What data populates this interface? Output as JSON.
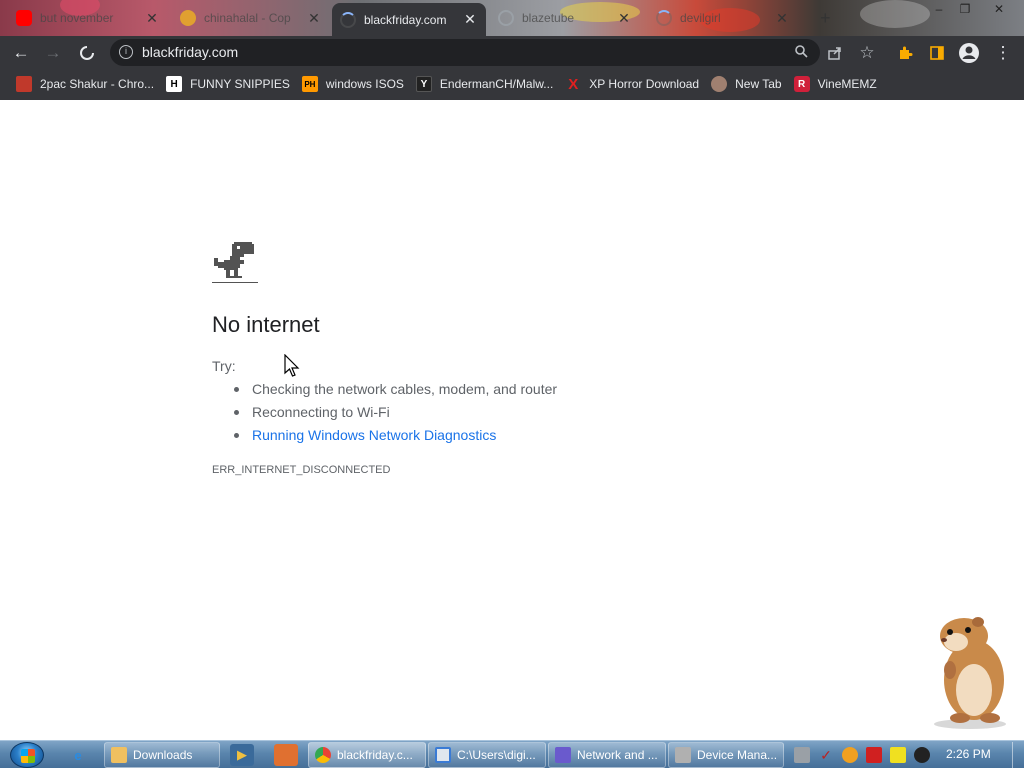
{
  "window": {
    "tabs": [
      {
        "title": "but november",
        "favicon": "youtube-icon",
        "color": "#ff0000"
      },
      {
        "title": "chinahalal - Cop",
        "favicon": "site-favicon-icon",
        "color": "#e0a030"
      },
      {
        "title": "blackfriday.com",
        "favicon": "loading-spinner-icon",
        "active": true
      },
      {
        "title": "blazetube",
        "favicon": "globe-icon",
        "color": "#9aa0a6"
      },
      {
        "title": "devilgirl",
        "favicon": "loading-spinner-icon"
      }
    ],
    "new_tab": "+",
    "controls": {
      "minimize": "–",
      "restore": "❐",
      "close": "✕"
    }
  },
  "toolbar": {
    "back": "←",
    "forward": "→",
    "reload": "✕",
    "url": "blackfriday.com",
    "info": "i",
    "icons": [
      "search-icon",
      "share-icon",
      "bookmark-star-icon",
      "extensions-icon",
      "side-panel-icon",
      "profile-icon",
      "menu-icon"
    ]
  },
  "bookmarks": [
    {
      "label": "2pac Shakur - Chro...",
      "icon": "image-icon",
      "text": "",
      "color": "#c0392b"
    },
    {
      "label": "FUNNY SNIPPIES",
      "icon": "h-letter-icon",
      "text": "H",
      "color": "#ffffff"
    },
    {
      "label": "windows ISOS",
      "icon": "ph-icon",
      "text": "PH",
      "color": "#ff9900"
    },
    {
      "label": "EndermanCH/Malw...",
      "icon": "youtube-icon",
      "text": "Y",
      "color": "#222222"
    },
    {
      "label": "XP Horror Download",
      "icon": "x-letter-icon",
      "text": "X",
      "color": "#e02020"
    },
    {
      "label": "New Tab",
      "icon": "globe-icon",
      "text": "",
      "color": "#a08070"
    },
    {
      "label": "VineMEMZ",
      "icon": "r-letter-icon",
      "text": "R",
      "color": "#d0203a"
    }
  ],
  "page": {
    "title": "No internet",
    "try": "Try:",
    "suggestions": [
      "Checking the network cables, modem, and router",
      "Reconnecting to Wi-Fi"
    ],
    "diagnostics_link": "Running Windows Network Diagnostics",
    "error_code": "ERR_INTERNET_DISCONNECTED"
  },
  "taskbar": {
    "buttons": [
      {
        "label": "Downloads",
        "icon": "folder-icon",
        "color": "#f0c060"
      },
      {
        "label": "blackfriday.c...",
        "icon": "chrome-icon",
        "color": "#4285f4",
        "active": true
      },
      {
        "label": "C:\\Users\\digi...",
        "icon": "explorer-icon",
        "color": "#3a7bd5"
      },
      {
        "label": "Network and ...",
        "icon": "network-icon",
        "color": "#6a5acd"
      },
      {
        "label": "Device Mana...",
        "icon": "device-manager-icon",
        "color": "#b0b0b0"
      }
    ],
    "clock": "2:26 PM"
  }
}
